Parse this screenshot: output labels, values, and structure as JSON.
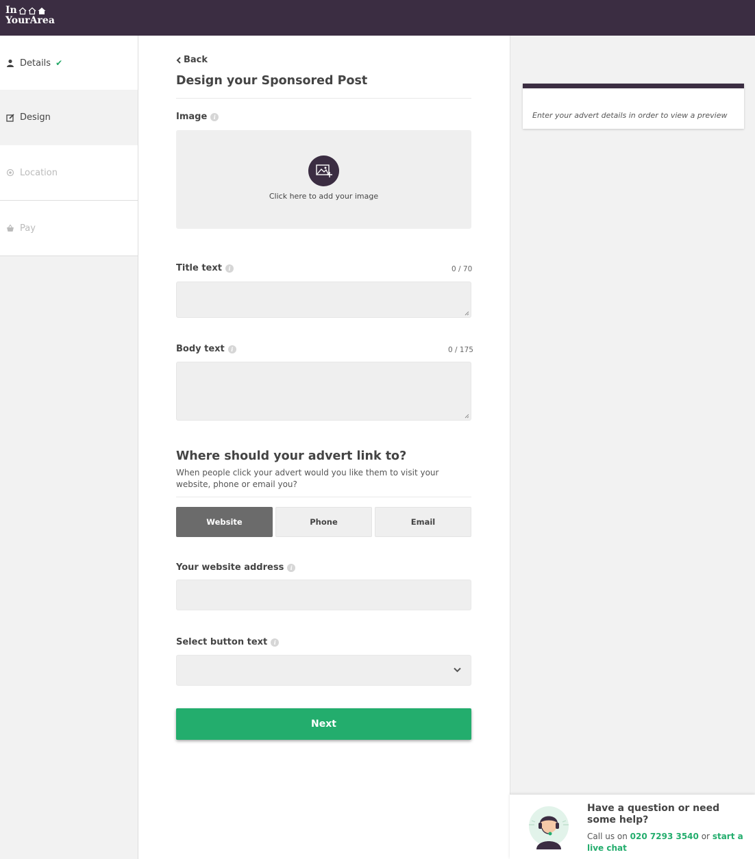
{
  "brand": {
    "logo_line1": "In",
    "logo_line2": "YourArea"
  },
  "sidebar": {
    "items": [
      {
        "label": "Details",
        "state": "completed"
      },
      {
        "label": "Design",
        "state": "active"
      },
      {
        "label": "Location",
        "state": "disabled"
      },
      {
        "label": "Pay",
        "state": "disabled"
      }
    ]
  },
  "form": {
    "back_label": "Back",
    "page_title": "Design your Sponsored Post",
    "image_label": "Image",
    "image_upload_text": "Click here to add your image",
    "title_label": "Title text",
    "title_counter": "0 / 70",
    "body_label": "Body text",
    "body_counter": "0 / 175",
    "link_section_title": "Where should your advert link to?",
    "link_section_desc": "When people click your advert would you like them to visit your website, phone or email you?",
    "link_options": [
      "Website",
      "Phone",
      "Email"
    ],
    "link_selected": "Website",
    "website_label": "Your website address",
    "button_text_label": "Select button text",
    "next_label": "Next"
  },
  "preview": {
    "message": "Enter your advert details in order to view a preview"
  },
  "help": {
    "title": "Have a question or need some help?",
    "call_prefix": "Call us on",
    "phone": "020 7293 3540",
    "or_text": "or",
    "chat_link": "start a live chat"
  },
  "colors": {
    "brand_purple": "#3b2d42",
    "accent_green": "#23ad6d",
    "selected_grey": "#6b6b6b"
  }
}
